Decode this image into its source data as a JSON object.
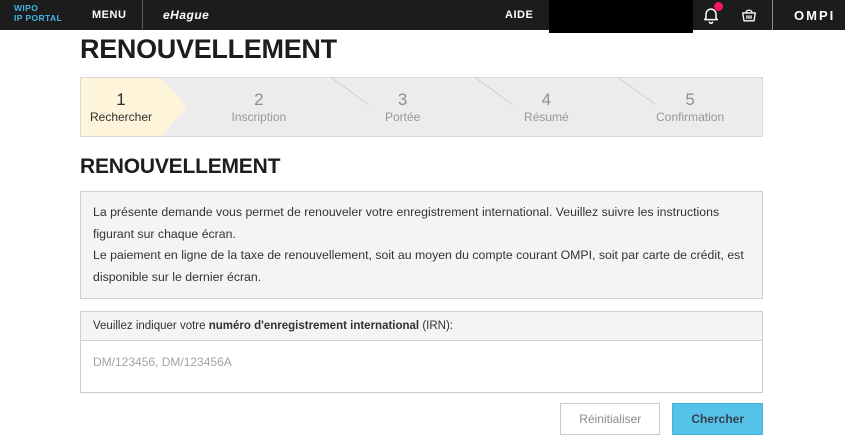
{
  "header": {
    "logo_line1": "WIPO",
    "logo_line2": "IP PORTAL",
    "menu_label": "MENU",
    "app_name": "eHague",
    "aide_label": "AIDE",
    "ompi_label": "OMPI",
    "icons": {
      "bell": "bell-icon",
      "cart": "basket-icon"
    }
  },
  "page": {
    "title": "RENOUVELLEMENT"
  },
  "stepper": {
    "steps": [
      {
        "num": "1",
        "label": "Rechercher",
        "active": true
      },
      {
        "num": "2",
        "label": "Inscription",
        "active": false
      },
      {
        "num": "3",
        "label": "Portée",
        "active": false
      },
      {
        "num": "4",
        "label": "Résumé",
        "active": false
      },
      {
        "num": "5",
        "label": "Confirmation",
        "active": false
      }
    ]
  },
  "content": {
    "heading": "RENOUVELLEMENT",
    "intro": {
      "p1": "La présente demande vous permet de renouveler votre enregistrement international. Veuillez suivre les instructions figurant sur chaque écran.",
      "p2": "Le paiement en ligne de la taxe de renouvellement, soit au moyen du compte courant OMPI, soit par carte de crédit, est disponible sur le dernier écran."
    },
    "irn": {
      "label_prefix": "Veuillez indiquer votre ",
      "label_bold": "numéro d'enregistrement international",
      "label_suffix": " (IRN):",
      "placeholder": "DM/123456, DM/123456A"
    },
    "actions": {
      "reset": "Réinitialiser",
      "search": "Chercher"
    }
  },
  "colors": {
    "header_bg": "#1c1c1c",
    "wipo_blue": "#41b6e6",
    "badge_pink": "#fb1465",
    "step_active_bg": "#fdf4d9",
    "accent_blue": "#57c2e9"
  }
}
